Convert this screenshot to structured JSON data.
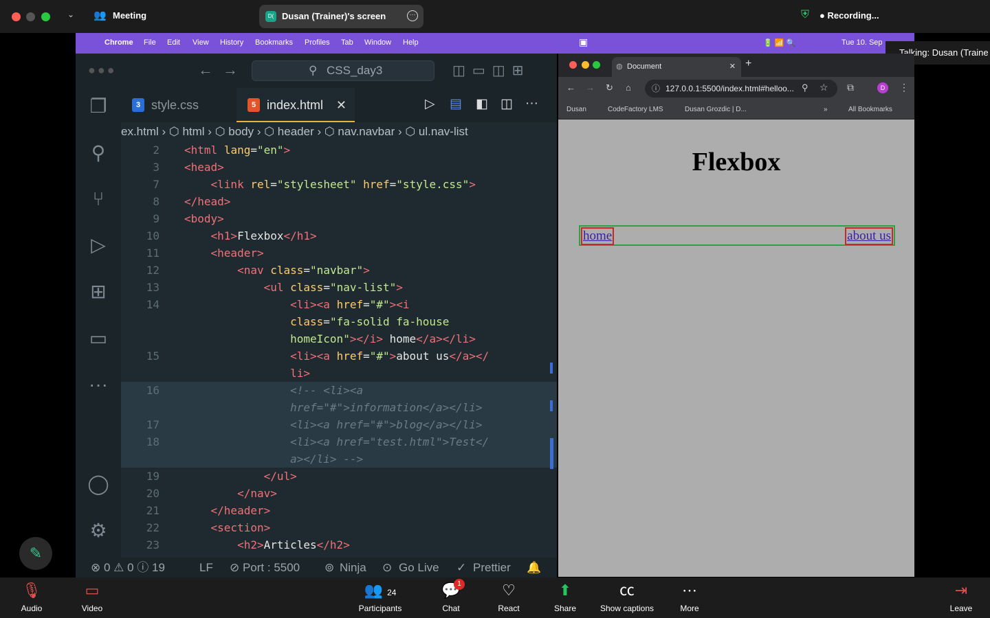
{
  "zoom": {
    "meeting_title": "Meeting",
    "share_badge": "D(",
    "share_label": "Dusan (Trainer)'s screen",
    "recording": "● Recording...",
    "talking": "Talking: Dusan (Traine",
    "dock": {
      "audio": "Audio",
      "video": "Video",
      "participants": "Participants",
      "participants_count": "24",
      "chat": "Chat",
      "chat_badge": "1",
      "react": "React",
      "share": "Share",
      "captions": "Show captions",
      "more": "More",
      "leave": "Leave"
    }
  },
  "macmenu": [
    "Chrome",
    "File",
    "Edit",
    "View",
    "History",
    "Bookmarks",
    "Profiles",
    "Tab",
    "Window",
    "Help"
  ],
  "macmenu_right": {
    "date": "Tue 10. Sep"
  },
  "vscode": {
    "search": "CSS_day3",
    "tabs": [
      {
        "label": "style.css",
        "icon": "3"
      },
      {
        "label": "index.html",
        "icon": "5"
      }
    ],
    "breadcrumb": "ex.html  ›  ⬡ html  ›  ⬡ body  ›  ⬡ header  ›  ⬡ nav.navbar  ›  ⬡ ul.nav-list",
    "lines": [
      {
        "n": "2",
        "html": "<span class='tag'>&lt;html</span> <span class='attr'>lang</span><span class='txt'>=</span><span class='str'>\"en\"</span><span class='tag'>&gt;</span>"
      },
      {
        "n": "3",
        "html": "<span class='tag'>&lt;head&gt;</span>"
      },
      {
        "n": "7",
        "html": "    <span class='tag'>&lt;link</span> <span class='attr'>rel</span><span class='txt'>=</span><span class='str'>\"stylesheet\"</span> <span class='attr'>href</span><span class='txt'>=</span><span class='str'>\"style.css\"</span><span class='tag'>&gt;</span>"
      },
      {
        "n": "8",
        "html": "<span class='tag'>&lt;/head&gt;</span>"
      },
      {
        "n": "9",
        "html": "<span class='tag'>&lt;body&gt;</span>"
      },
      {
        "n": "10",
        "html": "    <span class='tag'>&lt;h1&gt;</span><span class='txt'>Flexbox</span><span class='tag'>&lt;/h1&gt;</span>"
      },
      {
        "n": "11",
        "html": "    <span class='tag'>&lt;header&gt;</span>"
      },
      {
        "n": "12",
        "html": "        <span class='tag'>&lt;nav</span> <span class='attr'>class</span><span class='txt'>=</span><span class='str'>\"navbar\"</span><span class='tag'>&gt;</span>"
      },
      {
        "n": "13",
        "html": "            <span class='tag'>&lt;ul</span> <span class='attr'>class</span><span class='txt'>=</span><span class='str'>\"nav-list\"</span><span class='tag'>&gt;</span>"
      },
      {
        "n": "14",
        "html": "                <span class='tag'>&lt;li&gt;&lt;a</span> <span class='attr'>href</span><span class='txt'>=</span><span class='str'>\"#\"</span><span class='tag'>&gt;&lt;i</span>"
      },
      {
        "n": "",
        "html": "                <span class='attr'>class</span><span class='txt'>=</span><span class='str'>\"fa-solid fa-house</span>"
      },
      {
        "n": "",
        "html": "                <span class='str'>homeIcon\"</span><span class='tag'>&gt;&lt;/i&gt;</span><span class='txt'> home</span><span class='tag'>&lt;/a&gt;&lt;/li&gt;</span>"
      },
      {
        "n": "15",
        "html": "                <span class='tag'>&lt;li&gt;&lt;a</span> <span class='attr'>href</span><span class='txt'>=</span><span class='str'>\"#\"</span><span class='tag'>&gt;</span><span class='txt'>about us</span><span class='tag'>&lt;/a&gt;&lt;/</span>"
      },
      {
        "n": "",
        "html": "                <span class='tag'>li&gt;</span>"
      },
      {
        "n": "16",
        "html": "                <span class='cmt'>&lt;!-- &lt;li&gt;&lt;a</span>"
      },
      {
        "n": "",
        "html": "                <span class='cmt'>href=\"#\"&gt;information&lt;/a&gt;&lt;/li&gt;</span>"
      },
      {
        "n": "17",
        "html": "                <span class='cmt'>&lt;li&gt;&lt;a href=\"#\"&gt;blog&lt;/a&gt;&lt;/li&gt;</span>"
      },
      {
        "n": "18",
        "html": "                <span class='cmt'>&lt;li&gt;&lt;a href=\"test.html\"&gt;Test&lt;/</span>"
      },
      {
        "n": "",
        "html": "                <span class='cmt'>a&gt;&lt;/li&gt; --&gt;</span>"
      },
      {
        "n": "19",
        "html": "            <span class='tag'>&lt;/ul&gt;</span>"
      },
      {
        "n": "20",
        "html": "        <span class='tag'>&lt;/nav&gt;</span>"
      },
      {
        "n": "21",
        "html": "    <span class='tag'>&lt;/header&gt;</span>"
      },
      {
        "n": "22",
        "html": "    <span class='tag'>&lt;section&gt;</span>"
      },
      {
        "n": "23",
        "html": "        <span class='tag'>&lt;h2&gt;</span><span class='txt'>Articles</span><span class='tag'>&lt;/h2&gt;</span>"
      }
    ],
    "status": {
      "problems": "⊗ 0 ⚠ 0 ⓘ 19",
      "eol": "LF",
      "port": "⊘ Port : 5500",
      "ninja": "Ninja",
      "golive": "Go Live",
      "prettier": "Prettier"
    }
  },
  "browser": {
    "tab_title": "Document",
    "url": "127.0.0.1:5500/index.html#helloo...",
    "bookmarks": [
      "Dusan",
      "CodeFactory LMS",
      "Dusan Grozdic | D...",
      "All Bookmarks"
    ],
    "page": {
      "h1": "Flexbox",
      "nav": [
        "home",
        "about us"
      ]
    }
  }
}
